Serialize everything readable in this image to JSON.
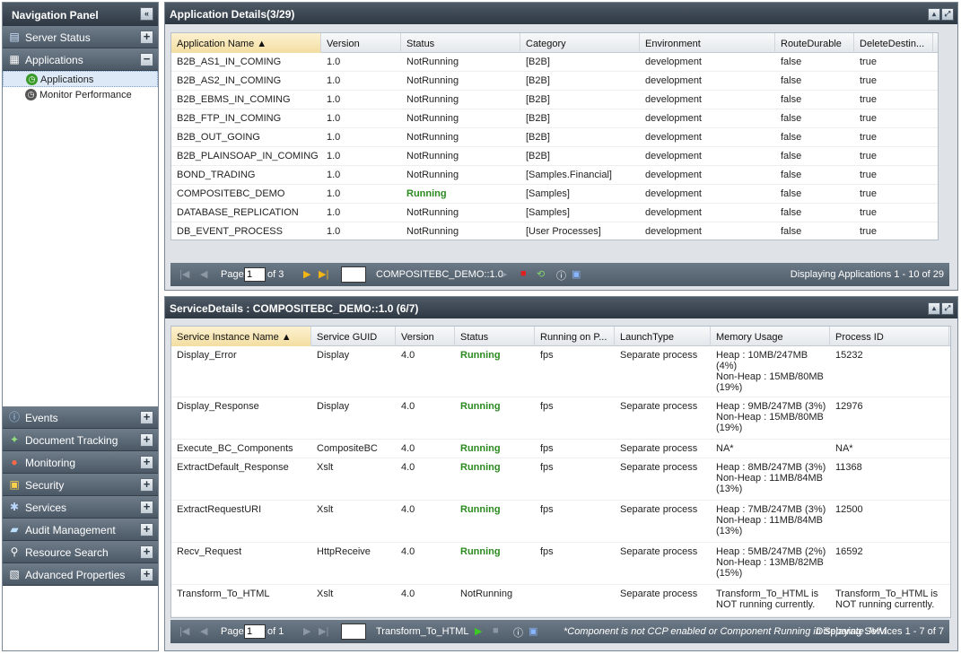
{
  "nav": {
    "title": "Navigation Panel",
    "sections_top": [
      {
        "label": "Server Status",
        "icon": "server-icon",
        "toggle": "+"
      },
      {
        "label": "Applications",
        "icon": "applications-icon",
        "toggle": "−"
      }
    ],
    "app_items": [
      {
        "label": "Applications",
        "icon": "applications-clock-icon"
      },
      {
        "label": "Monitor Performance",
        "icon": "monitor-clock-icon"
      }
    ],
    "sections_bottom": [
      {
        "label": "Events",
        "icon": "info-icon"
      },
      {
        "label": "Document Tracking",
        "icon": "tracking-icon"
      },
      {
        "label": "Monitoring",
        "icon": "monitoring-icon"
      },
      {
        "label": "Security",
        "icon": "lock-icon"
      },
      {
        "label": "Services",
        "icon": "services-icon"
      },
      {
        "label": "Audit Management",
        "icon": "audit-icon"
      },
      {
        "label": "Resource Search",
        "icon": "search-icon"
      },
      {
        "label": "Advanced Properties",
        "icon": "properties-icon"
      }
    ]
  },
  "app_panel": {
    "title": "Application Details(3/29)",
    "columns": [
      "Application Name ▲",
      "Version",
      "Status",
      "Category",
      "Environment",
      "RouteDurable",
      "DeleteDestin..."
    ],
    "rows": [
      [
        "B2B_AS1_IN_COMING",
        "1.0",
        "NotRunning",
        "[B2B]",
        "development",
        "false",
        "true"
      ],
      [
        "B2B_AS2_IN_COMING",
        "1.0",
        "NotRunning",
        "[B2B]",
        "development",
        "false",
        "true"
      ],
      [
        "B2B_EBMS_IN_COMING",
        "1.0",
        "NotRunning",
        "[B2B]",
        "development",
        "false",
        "true"
      ],
      [
        "B2B_FTP_IN_COMING",
        "1.0",
        "NotRunning",
        "[B2B]",
        "development",
        "false",
        "true"
      ],
      [
        "B2B_OUT_GOING",
        "1.0",
        "NotRunning",
        "[B2B]",
        "development",
        "false",
        "true"
      ],
      [
        "B2B_PLAINSOAP_IN_COMING",
        "1.0",
        "NotRunning",
        "[B2B]",
        "development",
        "false",
        "true"
      ],
      [
        "BOND_TRADING",
        "1.0",
        "NotRunning",
        "[Samples.Financial]",
        "development",
        "false",
        "true"
      ],
      [
        "COMPOSITEBC_DEMO",
        "1.0",
        "Running",
        "[Samples]",
        "development",
        "false",
        "true"
      ],
      [
        "DATABASE_REPLICATION",
        "1.0",
        "NotRunning",
        "[Samples]",
        "development",
        "false",
        "true"
      ],
      [
        "DB_EVENT_PROCESS",
        "1.0",
        "NotRunning",
        "[User Processes]",
        "development",
        "false",
        "true"
      ]
    ],
    "pager": {
      "page_label": "Page",
      "page_value": "1",
      "of_label": "of 3",
      "selected": "COMPOSITEBC_DEMO::1.0",
      "display": "Displaying Applications 1 - 10 of 29"
    }
  },
  "svc_panel": {
    "title": "ServiceDetails : COMPOSITEBC_DEMO::1.0 (6/7)",
    "columns": [
      "Service Instance Name ▲",
      "Service GUID",
      "Version",
      "Status",
      "Running on P...",
      "LaunchType",
      "Memory Usage",
      "Process ID"
    ],
    "rows": [
      [
        "Display_Error",
        "Display",
        "4.0",
        "Running",
        "fps",
        "Separate process",
        "Heap : 10MB/247MB (4%)\nNon-Heap : 15MB/80MB (19%)",
        "15232"
      ],
      [
        "Display_Response",
        "Display",
        "4.0",
        "Running",
        "fps",
        "Separate process",
        "Heap : 9MB/247MB (3%)\nNon-Heap : 15MB/80MB (19%)",
        "12976"
      ],
      [
        "Execute_BC_Components",
        "CompositeBC",
        "4.0",
        "Running",
        "fps",
        "Separate process",
        "NA*",
        "NA*"
      ],
      [
        "ExtractDefault_Response",
        "Xslt",
        "4.0",
        "Running",
        "fps",
        "Separate process",
        "Heap : 8MB/247MB (3%)\nNon-Heap : 11MB/84MB (13%)",
        "11368"
      ],
      [
        "ExtractRequestURI",
        "Xslt",
        "4.0",
        "Running",
        "fps",
        "Separate process",
        "Heap : 7MB/247MB (3%)\nNon-Heap : 11MB/84MB (13%)",
        "12500"
      ],
      [
        "Recv_Request",
        "HttpReceive",
        "4.0",
        "Running",
        "fps",
        "Separate process",
        "Heap : 5MB/247MB (2%)\nNon-Heap : 13MB/82MB (15%)",
        "16592"
      ],
      [
        "Transform_To_HTML",
        "Xslt",
        "4.0",
        "NotRunning",
        "",
        "Separate process",
        "Transform_To_HTML is NOT running currently.",
        "Transform_To_HTML is NOT running currently."
      ]
    ],
    "pager": {
      "page_label": "Page",
      "page_value": "1",
      "of_label": "of 1",
      "selected": "Transform_To_HTML",
      "note": "*Component is not CCP enabled or Component Running in Separate JVM",
      "display": "Displaying Services 1 - 7 of 7"
    }
  }
}
